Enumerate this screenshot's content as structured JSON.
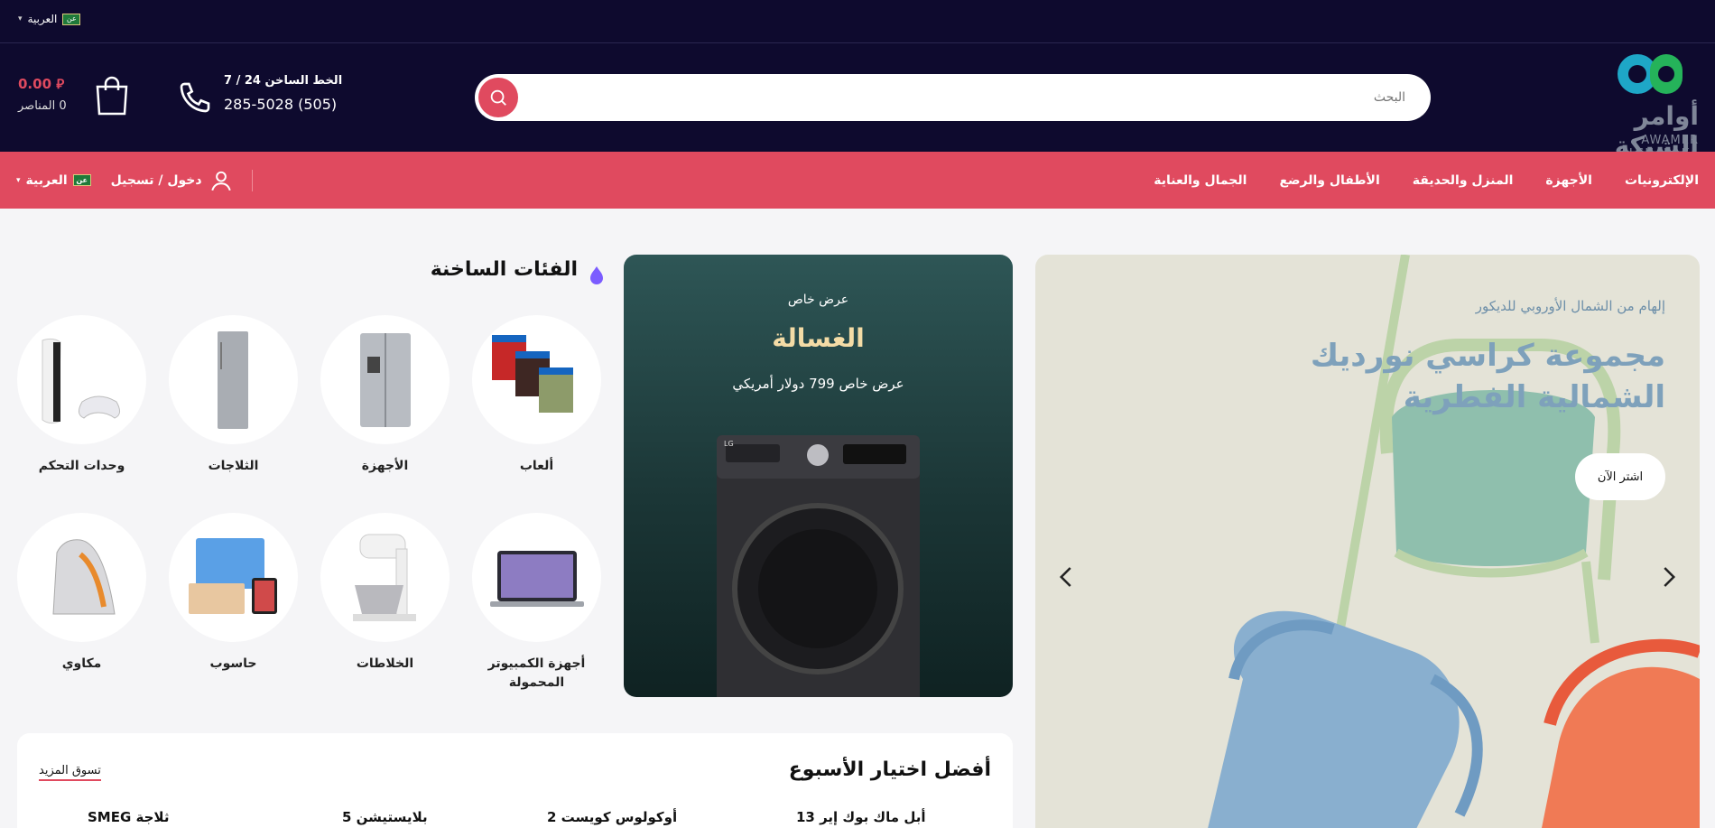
{
  "topbar": {
    "language": "العربية",
    "flag_text": "عن"
  },
  "header": {
    "logo_text": "أوامر الشبكة",
    "logo_subtext": "AWAMER ALSHABAKA",
    "search_placeholder": "البحث",
    "hotline_label": "الخط الساخن 24 / 7",
    "hotline_number": "285-5028 (505)",
    "cart_total": "0.00 ⃁",
    "cart_count": "0 المناصر"
  },
  "nav": {
    "items": [
      "الإلكترونيات",
      "الأجهزة",
      "المنزل والحديقة",
      "الأطفال والرضع",
      "الجمال والعناية"
    ],
    "login": "دخول / تسجيل",
    "language": "العربية",
    "flag_text": "عن"
  },
  "hero": {
    "subtitle": "إلهام من الشمال الأوروبي للديكور",
    "title": "مجموعة كراسي نورديك الشمالية الفطرية",
    "button": "اشتر الآن"
  },
  "promo": {
    "tag": "عرض خاص",
    "title": "الغسالة",
    "price": "عرض خاص 799 دولار أمريكي",
    "brand": "LG"
  },
  "hot_categories": {
    "title": "الفئات الساخنة",
    "items": [
      "ألعاب",
      "الأجهزة",
      "الثلاجات",
      "وحدات التحكم",
      "أجهزة الكمبيوتر المحمولة",
      "الخلاطات",
      "حاسوب",
      "مكاوي"
    ]
  },
  "best_picks": {
    "title": "أفضل اختيار الأسبوع",
    "more": "تسوق المزيد",
    "products": [
      "أبل ماك بوك إير 13",
      "أوكولوس كويست 2",
      "بلايستيشن 5",
      "ثلاجة SMEG"
    ]
  },
  "colors": {
    "dark": "#0e0a2e",
    "accent": "#e04a5f",
    "promo_bg": "#1b3636",
    "hero_bg": "#e4e3d7"
  }
}
